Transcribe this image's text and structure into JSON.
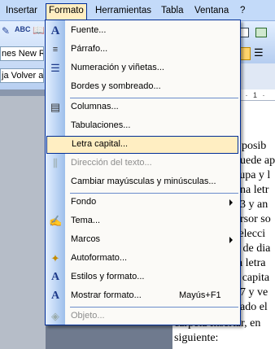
{
  "menubar": {
    "items": [
      {
        "label": "Insertar"
      },
      {
        "label": "Formato"
      },
      {
        "label": "Herramientas"
      },
      {
        "label": "Tabla"
      },
      {
        "label": "Ventana"
      },
      {
        "label": "?"
      }
    ]
  },
  "toolbar_left": {
    "font_name": "nes New Ro",
    "style_box": "ja Volver a"
  },
  "ruler_right": "· · 1 · 3 ·",
  "menu": {
    "items": [
      {
        "label": "Fuente...",
        "icon": "font-icon"
      },
      {
        "label": "Párrafo...",
        "icon": "paragraph-icon"
      },
      {
        "label": "Numeración y viñetas...",
        "icon": "bullets-icon"
      },
      {
        "label": "Bordes y sombreado...",
        "icon": ""
      },
      {
        "label": "Columnas...",
        "icon": "columns-icon"
      },
      {
        "label": "Tabulaciones...",
        "icon": ""
      },
      {
        "label": "Letra capital...",
        "icon": ""
      },
      {
        "label": "Dirección del texto...",
        "icon": "text-direction-icon",
        "disabled": true
      },
      {
        "label": "Cambiar mayúsculas y minúsculas...",
        "icon": ""
      },
      {
        "label": "Fondo",
        "icon": "",
        "submenu": true
      },
      {
        "label": "Tema...",
        "icon": "theme-icon"
      },
      {
        "label": "Marcos",
        "icon": "",
        "submenu": true
      },
      {
        "label": "Autoformato...",
        "icon": "autoformat-icon"
      },
      {
        "label": "Estilos y formato...",
        "icon": "styles-icon"
      },
      {
        "label": "Mostrar formato...",
        "icon": "reveal-format-icon",
        "shortcut": "Mayús+F1"
      },
      {
        "label": "Objeto...",
        "icon": "object-icon",
        "disabled": true
      }
    ]
  },
  "document": {
    "lines": [
      "s posib",
      "puede ap",
      "cupa y l",
      " una letr",
      "03 y an",
      "ursor so",
      "selecci",
      "o de dia",
      "la letra",
      "a capita",
      "07 y ve",
      "nado el",
      "carpeta Insertar, en",
      "siguiente:"
    ]
  }
}
